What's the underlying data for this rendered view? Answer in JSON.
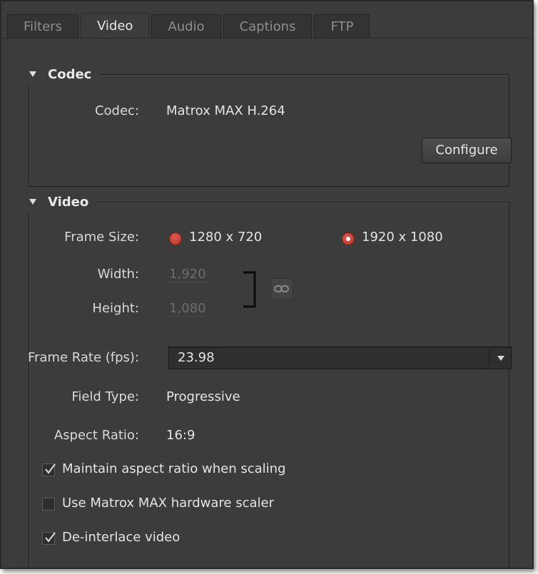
{
  "tabs": [
    "Filters",
    "Video",
    "Audio",
    "Captions",
    "FTP"
  ],
  "active_tab": "Video",
  "codec_section": {
    "title": "Codec",
    "codec_label": "Codec:",
    "codec_value": "Matrox MAX H.264",
    "configure_label": "Configure"
  },
  "video_section": {
    "title": "Video",
    "frame_size_label": "Frame Size:",
    "frame_size_options": [
      "1280 x 720",
      "1920 x 1080"
    ],
    "frame_size_selected": "1920 x 1080",
    "width_label": "Width:",
    "width_value": "1,920",
    "height_label": "Height:",
    "height_value": "1,080",
    "link_icon": "chain-link-icon",
    "frame_rate_label": "Frame Rate (fps):",
    "frame_rate_value": "23.98",
    "field_type_label": "Field Type:",
    "field_type_value": "Progressive",
    "aspect_ratio_label": "Aspect Ratio:",
    "aspect_ratio_value": "16:9",
    "checkboxes": [
      {
        "label": "Maintain aspect ratio when scaling",
        "checked": true
      },
      {
        "label": "Use Matrox MAX hardware scaler",
        "checked": false
      },
      {
        "label": "De-interlace video",
        "checked": true
      }
    ]
  },
  "colors": {
    "panel_bg": "#3c3c3c",
    "radio_red": "#c9392c"
  }
}
